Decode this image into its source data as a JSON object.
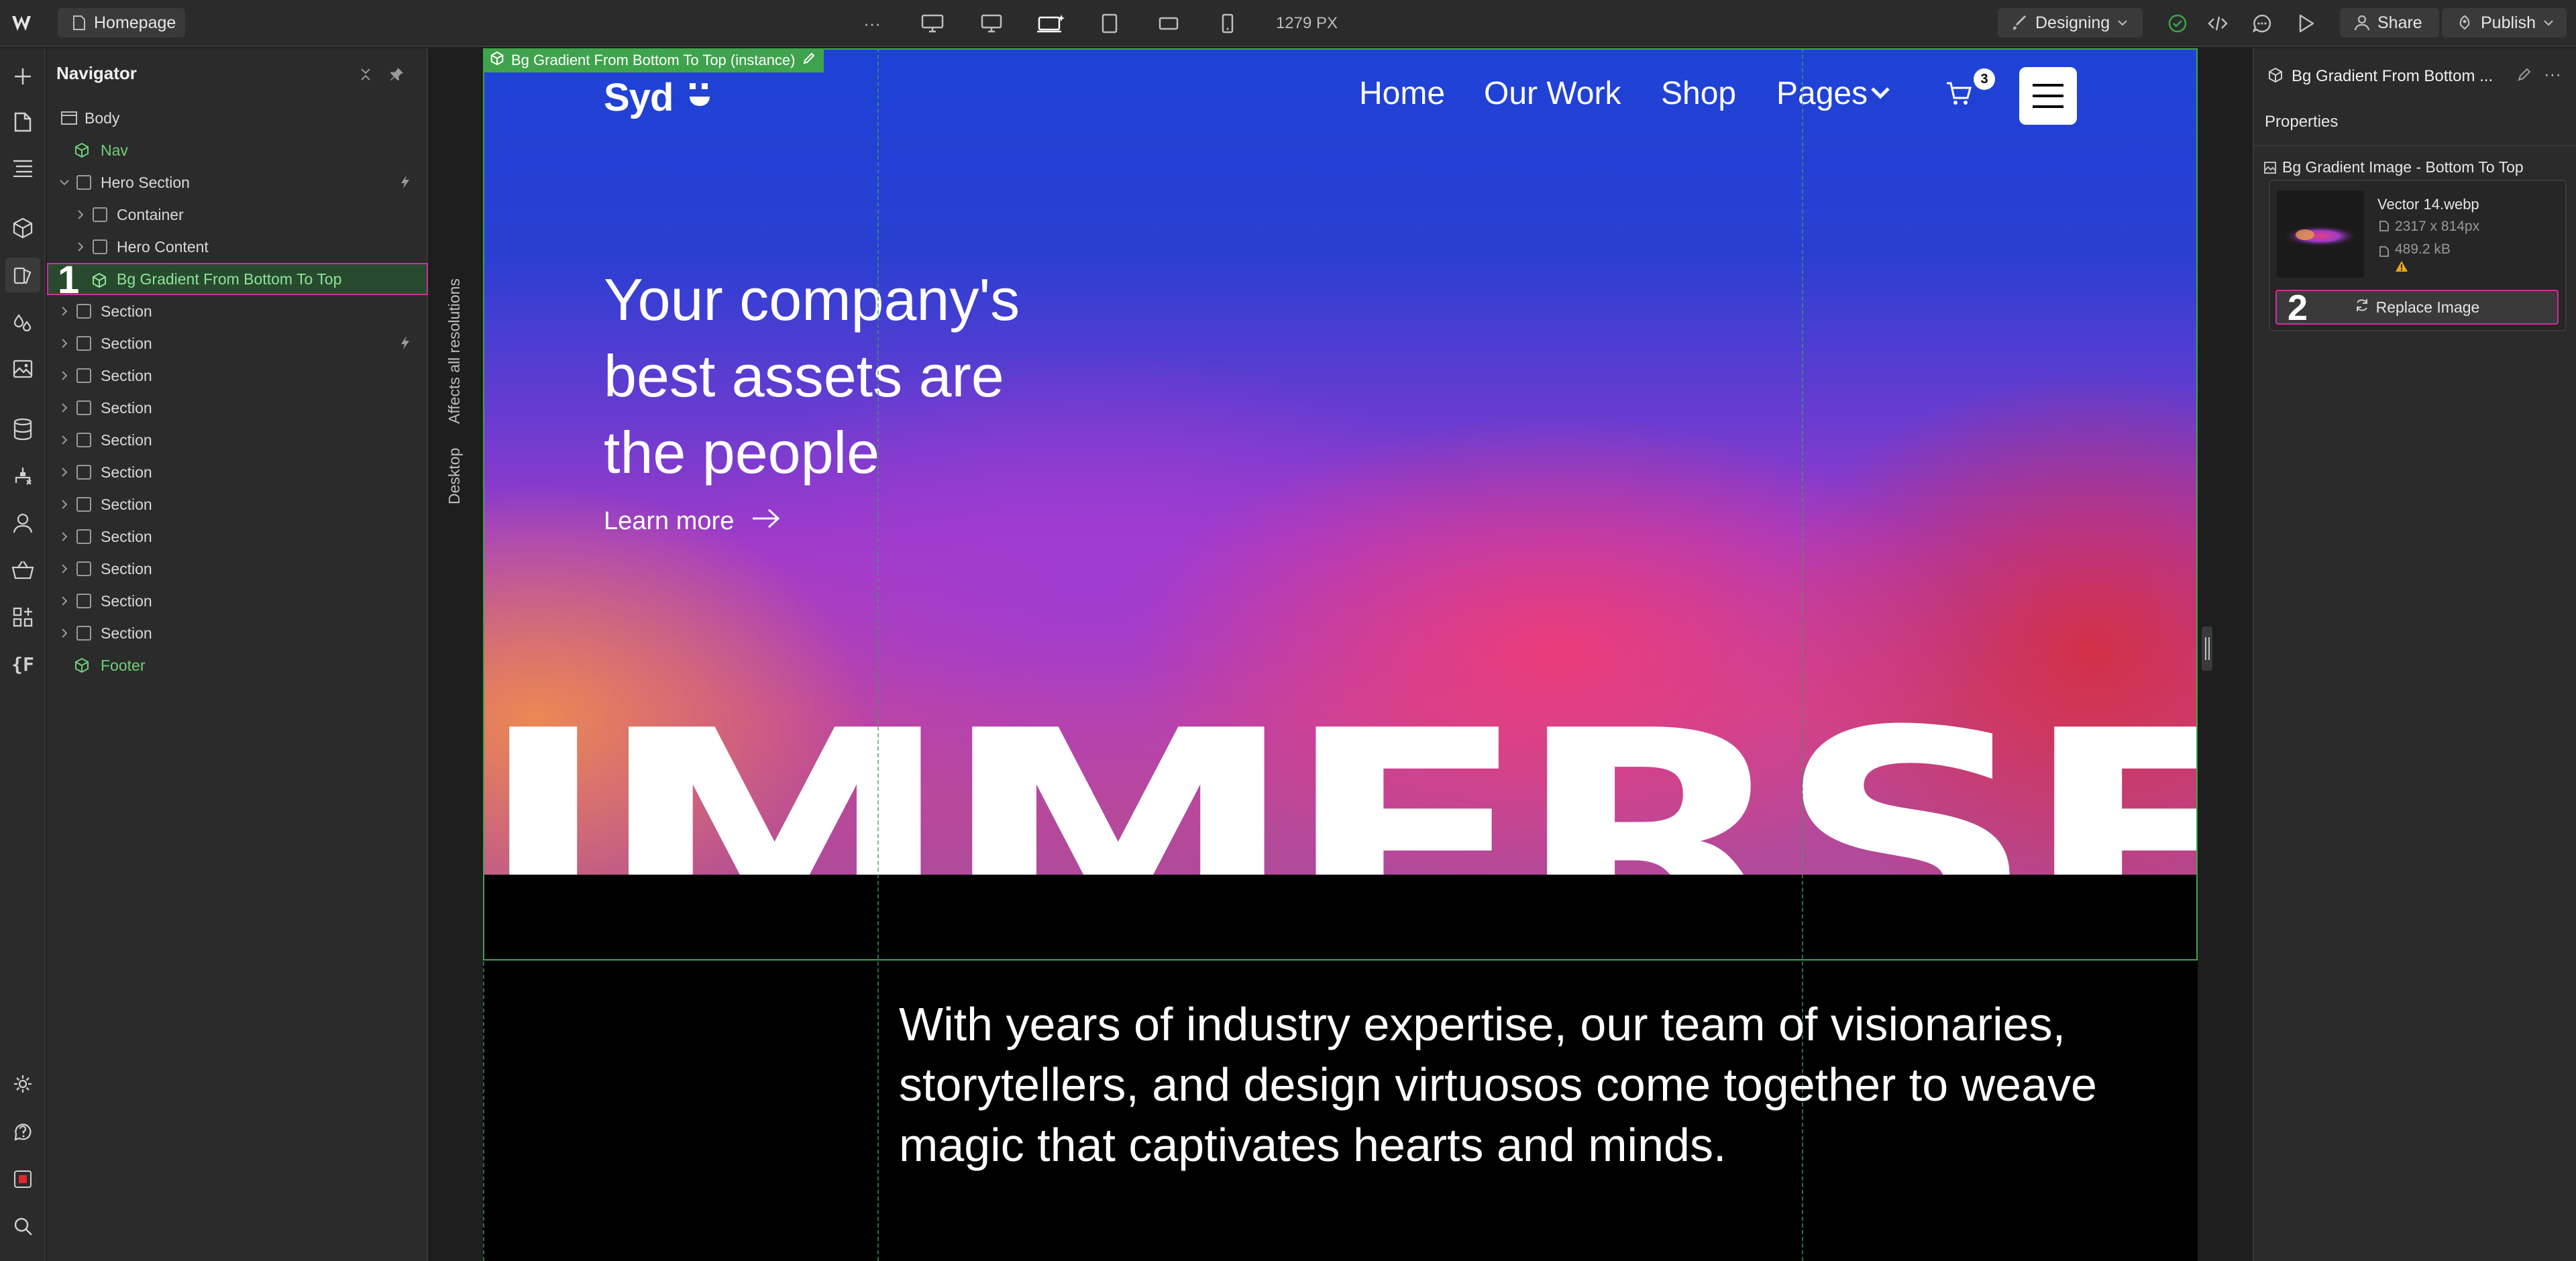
{
  "topbar": {
    "page_label": "Homepage",
    "more_label": "···",
    "width_readout": "1279 PX",
    "mode_label": "Designing",
    "share_label": "Share",
    "publish_label": "Publish"
  },
  "navigator": {
    "title": "Navigator",
    "items": [
      {
        "label": "Body"
      },
      {
        "label": "Nav"
      },
      {
        "label": "Hero Section"
      },
      {
        "label": "Container"
      },
      {
        "label": "Hero Content"
      },
      {
        "label": "Bg Gradient From Bottom To Top"
      },
      {
        "label": "Section"
      },
      {
        "label": "Section"
      },
      {
        "label": "Section"
      },
      {
        "label": "Section"
      },
      {
        "label": "Section"
      },
      {
        "label": "Section"
      },
      {
        "label": "Section"
      },
      {
        "label": "Section"
      },
      {
        "label": "Section"
      },
      {
        "label": "Section"
      },
      {
        "label": "Section"
      },
      {
        "label": "Footer"
      }
    ],
    "step_marker": "1"
  },
  "breakpoint_labels": {
    "affects": "Affects all resolutions",
    "desktop": "Desktop"
  },
  "canvas": {
    "selection_tag": "Bg Gradient From Bottom To Top (instance)",
    "site_nav": {
      "logo": "Syd",
      "links": [
        "Home",
        "Our Work",
        "Shop",
        "Pages"
      ],
      "cart_count": "3"
    },
    "hero": {
      "headline_lines": [
        "Your company's",
        "best assets are",
        "the people"
      ],
      "cta": "Learn more",
      "big_word": "IMMERSE"
    },
    "body_lines": [
      "With years of industry expertise, our team of visionaries,",
      "storytellers, and design virtuosos come together to weave",
      "magic that captivates hearts and minds."
    ]
  },
  "right_panel": {
    "element_title": "Bg Gradient From Bottom ...",
    "tab_label": "Properties",
    "image_field_label": "Bg Gradient Image - Bottom To Top",
    "file_name": "Vector 14.webp",
    "dimensions": "2317 x 814px",
    "file_size": "489.2 kB",
    "replace_label": "Replace Image",
    "step_marker": "2"
  },
  "colors": {
    "selection_green": "#3fa34d",
    "highlight_magenta": "#d02ea0",
    "panel_bg": "#2b2b2b",
    "app_bg": "#1e1e1e"
  }
}
